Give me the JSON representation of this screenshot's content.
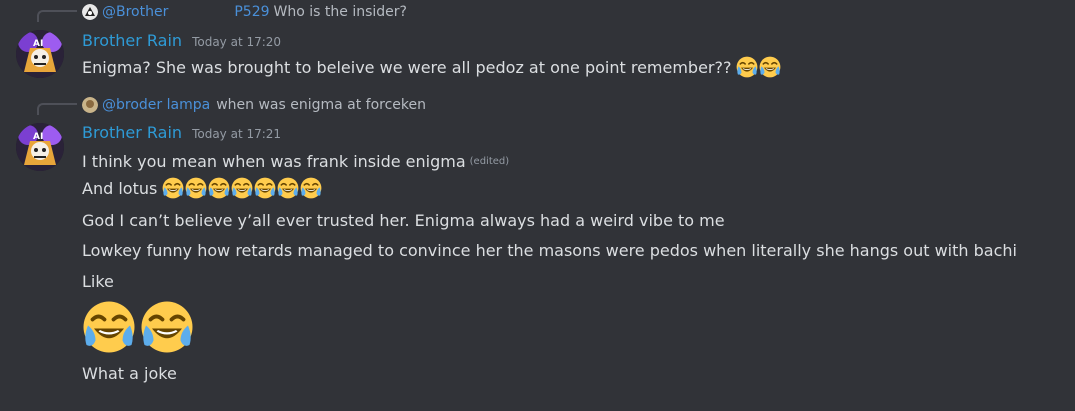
{
  "messages": [
    {
      "reply": {
        "name": "@Brother",
        "tag": "P529",
        "text": "Who is the insider?"
      },
      "author": "Brother Rain",
      "timestamp": "Today at 17:20",
      "line1": "Enigma? She was brought to beleive we were all pedoz at one point remember??"
    },
    {
      "reply": {
        "name": "@broder lampa",
        "text": "when was enigma at forceken"
      },
      "author": "Brother Rain",
      "timestamp": "Today at 17:21",
      "lines": [
        "I think you mean when was frank inside enigma",
        "And lotus",
        "God I can’t believe y’all ever trusted her.  Enigma always had a weird vibe to me",
        "Lowkey funny how retards managed to convince her the masons were pedos when literally she hangs out with bachi",
        "Like",
        "What a joke"
      ],
      "edited_label": "(edited)"
    }
  ],
  "emoji_name": "joy-tears-emoji",
  "colors": {
    "background": "#313338",
    "author": "#2e9bd6",
    "reply_name": "#4a90d9",
    "muted": "#949ba4",
    "text": "#dbdee1"
  }
}
